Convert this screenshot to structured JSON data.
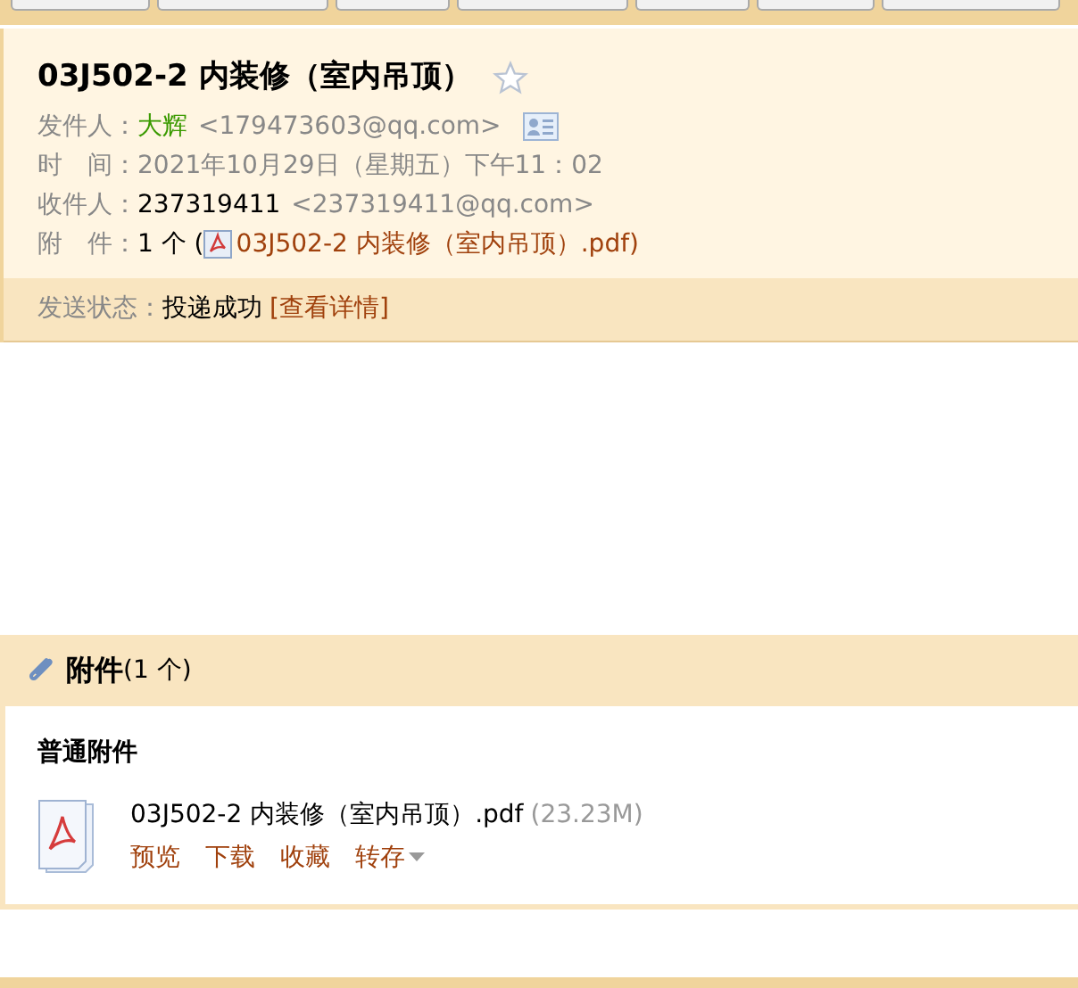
{
  "mail": {
    "subject": "03J502-2 内装修（室内吊顶）",
    "starred": false,
    "fields": [
      {
        "kind": "sender",
        "label": "发件人：",
        "name": "大辉",
        "address": "<179473603@qq.com>"
      },
      {
        "kind": "time",
        "label": "时　间：",
        "value": "2021年10月29日（星期五）下午11：02"
      },
      {
        "kind": "recipient",
        "label": "收件人：",
        "name": "237319411",
        "address": "<237319411@qq.com>"
      },
      {
        "kind": "attachment",
        "label": "附　件：",
        "count": "1 个 (",
        "file": "03J502-2 内装修（室内吊顶）.pdf",
        "close": ")"
      }
    ],
    "status": {
      "label": "发送状态：",
      "value": "投递成功",
      "link": "[查看详情]"
    }
  },
  "attachments": {
    "title": "附件",
    "count": "(1 个)",
    "group": "普通附件",
    "files": [
      {
        "name": "03J502-2 内装修（室内吊顶）.pdf",
        "size": "(23.23M)",
        "actions": [
          "预览",
          "下载",
          "收藏",
          "转存"
        ]
      }
    ]
  }
}
